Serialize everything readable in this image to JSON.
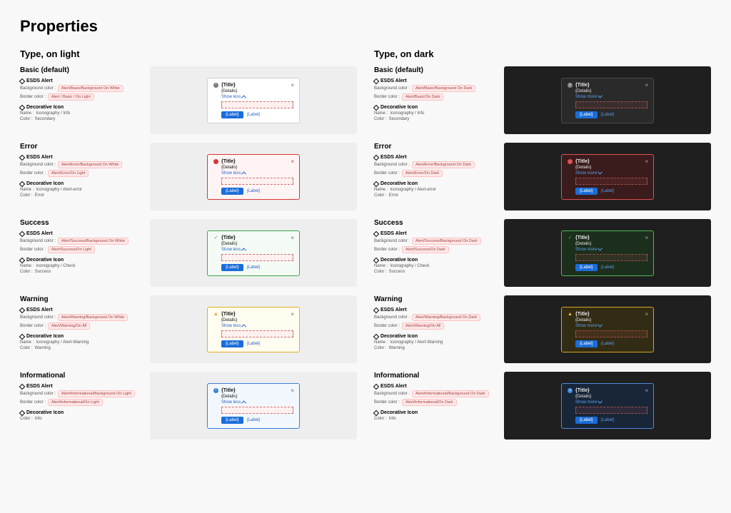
{
  "page_title": "Properties",
  "columns": {
    "light_heading": "Type, on light",
    "dark_heading": "Type, on dark"
  },
  "alert_template": {
    "title": "{Title}",
    "details": "{Details}",
    "toggle_less": "Show less",
    "toggle_more": "Show more",
    "btn_primary": "{Label}",
    "btn_link": "{Label}",
    "close": "×"
  },
  "meta_labels": {
    "esds_alert": "ESDS Alert",
    "decorative_icon": "Decorative Icon",
    "bg_color": "Background color :",
    "border_color": "Border color :",
    "name": "Name :",
    "color": "Color :"
  },
  "variants": {
    "basic": {
      "heading": "Basic (default)",
      "light": {
        "bg": "Alert/Basic/Background On White",
        "border": "Alert / Basic / On Light"
      },
      "dark": {
        "bg": "Alert/Basic/Background On Dark",
        "border": "Alert/Basic/On Dark"
      },
      "icon_name": "Iconography / Info",
      "icon_color": "Secondary"
    },
    "error": {
      "heading": "Error",
      "light": {
        "bg": "Alert/Error/Background On White",
        "border": "Alert/Error/On Light"
      },
      "dark": {
        "bg": "Alert/Error/Background On Dark",
        "border": "Alert/Error/On Dark"
      },
      "icon_name": "Iconography / Alert-error",
      "icon_color": "Error"
    },
    "success": {
      "heading": "Success",
      "light": {
        "bg": "Alert/Success/Background On White",
        "border": "Alert/Success/On Light"
      },
      "dark": {
        "bg": "Alert/Success/Background On Dark",
        "border": "Alert/Success/On Dark"
      },
      "icon_name": "Iconography / Check",
      "icon_color": "Success"
    },
    "warning": {
      "heading": "Warning",
      "light": {
        "bg": "Alert/Warning/Background On White",
        "border": "Alert/Warning/On All"
      },
      "dark": {
        "bg": "Alert/Warning/Background On Dark",
        "border": "Alert/Warning/On All"
      },
      "icon_name": "Iconography / Alert-Warning",
      "icon_color": "Warning"
    },
    "info": {
      "heading": "Informational",
      "light": {
        "bg": "Alert/Informational/Background On Light",
        "border": "Alert/Informational/On Light"
      },
      "dark": {
        "bg": "Alert/Informational/Background On Dark",
        "border": "Alert/Informational/On Dark"
      },
      "icon_color": "Info"
    }
  }
}
